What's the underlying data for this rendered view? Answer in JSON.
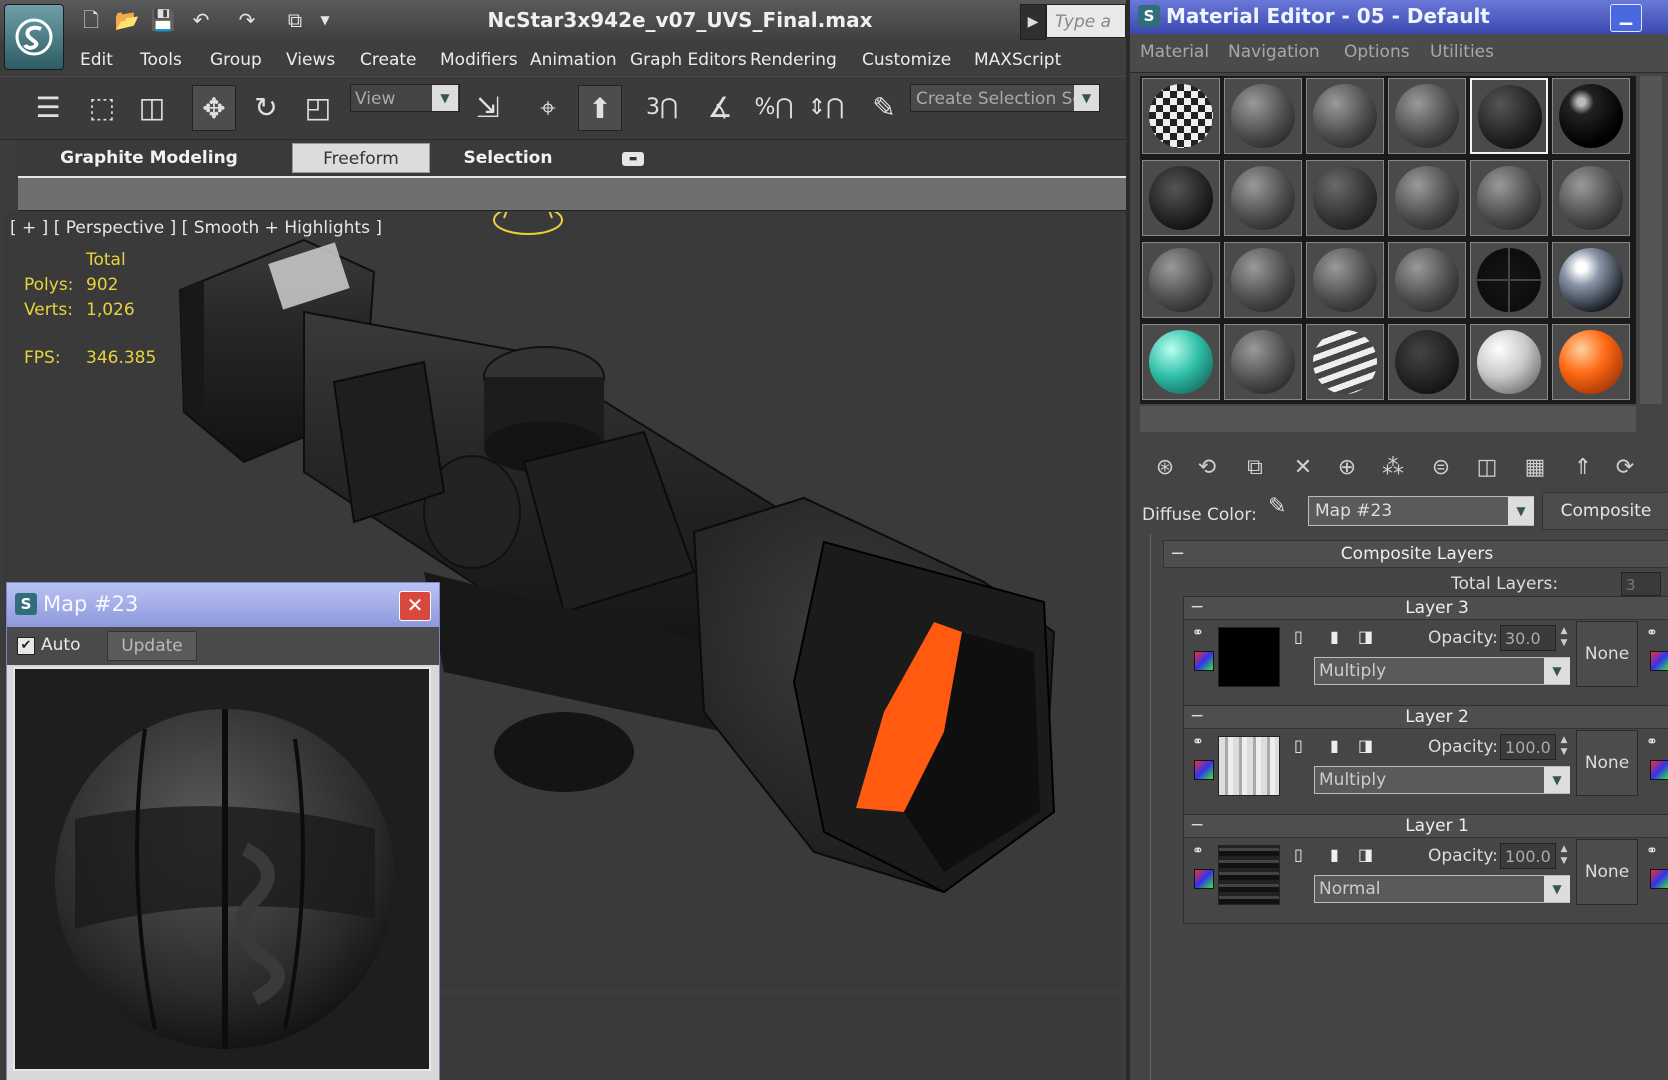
{
  "main_window": {
    "document_title": "NcStar3x942e_v07_UVS_Final.max",
    "search_placeholder": "Type a k",
    "menu": [
      "Edit",
      "Tools",
      "Group",
      "Views",
      "Create",
      "Modifiers",
      "Animation",
      "Graph Editors",
      "Rendering",
      "Customize",
      "MAXScript"
    ],
    "reference_coordinate_dropdown": "View",
    "named_selection_dropdown": "Create Selection Se",
    "ribbon_tabs": [
      "Graphite Modeling Tools",
      "Freeform",
      "Selection"
    ],
    "active_ribbon_tab": "Freeform"
  },
  "viewport": {
    "label": "[ + ] [ Perspective ] [ Smooth + Highlights ]",
    "stats": {
      "total_label": "Total",
      "polys_label": "Polys:",
      "polys_value": "902",
      "verts_label": "Verts:",
      "verts_value": "1,026",
      "fps_label": "FPS:",
      "fps_value": "346.385"
    },
    "lens_color": "#ff5a10",
    "stats_color": "#e8d33a"
  },
  "map_window": {
    "title": "Map #23",
    "auto_label": "Auto",
    "auto_checked": true,
    "update_label": "Update"
  },
  "material_editor": {
    "title": "Material Editor - 05 - Default",
    "menu": [
      "Material",
      "Navigation",
      "Options",
      "Utilities"
    ],
    "diffuse_label": "Diffuse Color:",
    "diffuse_map": "Map #23",
    "map_type_button": "Composite",
    "composite_rollout_title": "Composite Layers",
    "total_layers_label": "Total Layers:",
    "total_layers_value": "3",
    "layers": [
      {
        "name": "Layer 3",
        "opacity_label": "Opacity:",
        "opacity": "30.0",
        "blend_mode": "Multiply",
        "mask": "None"
      },
      {
        "name": "Layer 2",
        "opacity_label": "Opacity:",
        "opacity": "100.0",
        "blend_mode": "Multiply",
        "mask": "None"
      },
      {
        "name": "Layer 1",
        "opacity_label": "Opacity:",
        "opacity": "100.0",
        "blend_mode": "Normal",
        "mask": "None"
      }
    ],
    "slot_swatches": [
      "checker",
      "grey",
      "grey",
      "grey",
      "dark-selected",
      "black",
      "dark-textured",
      "grey",
      "darkgrey",
      "grey",
      "grey",
      "grey",
      "grey",
      "grey",
      "grey",
      "grey",
      "reticle",
      "chrome",
      "teal",
      "grey",
      "striped",
      "numbered",
      "white",
      "orange"
    ]
  }
}
